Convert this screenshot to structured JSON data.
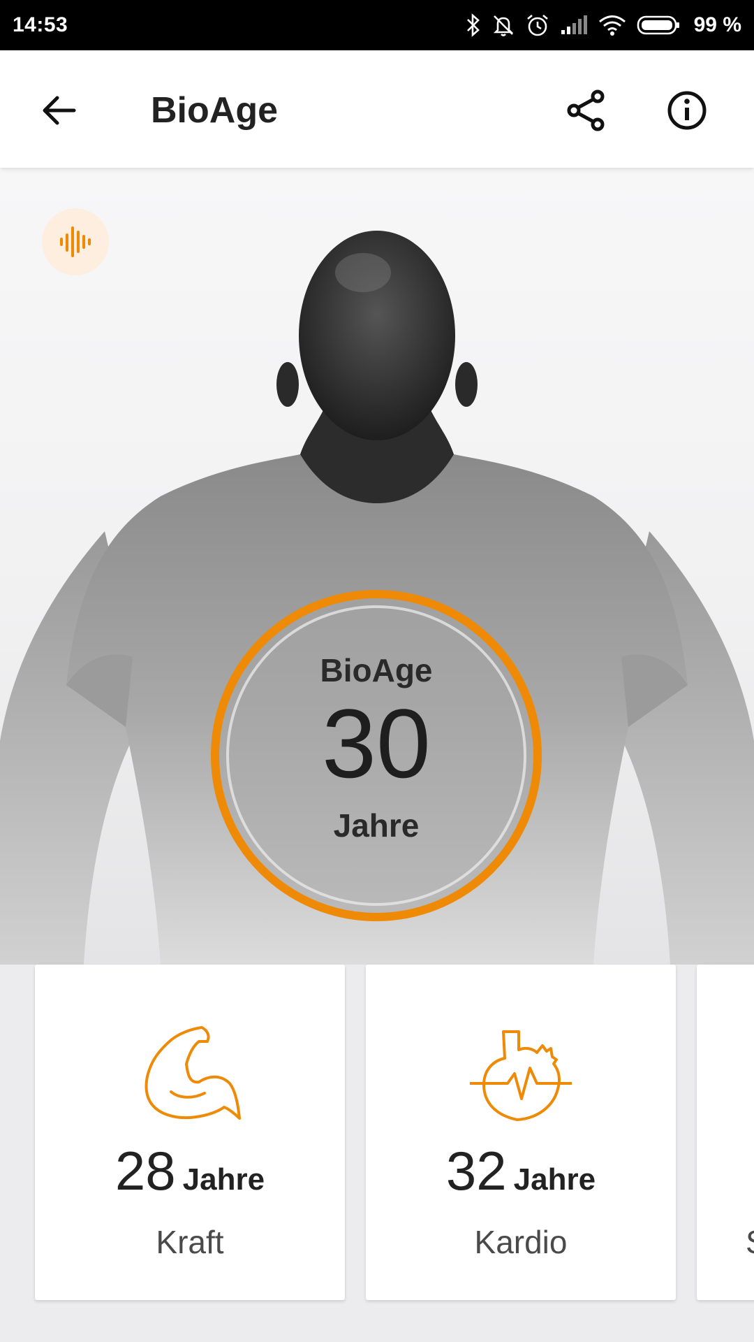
{
  "status_bar": {
    "time": "14:53",
    "battery": "99 %",
    "icons": [
      "bluetooth-icon",
      "bell-muted-icon",
      "alarm-icon",
      "signal-icon",
      "wifi-icon",
      "battery-icon"
    ]
  },
  "app_bar": {
    "title": "BioAge",
    "back_icon": "arrow-left-icon",
    "share_icon": "share-icon",
    "info_icon": "info-icon"
  },
  "hero": {
    "audio_icon": "audio-wave-icon",
    "bioage_label": "BioAge",
    "bioage_value": "30",
    "bioage_unit": "Jahre"
  },
  "cards": [
    {
      "icon": "muscle-arm-icon",
      "value": "28",
      "unit": "Jahre",
      "label": "Kraft"
    },
    {
      "icon": "heart-pulse-icon",
      "value": "32",
      "unit": "Jahre",
      "label": "Kardio"
    },
    {
      "label": "S"
    }
  ],
  "colors": {
    "accent": "#ee8a06",
    "accent_light": "#fdeee0",
    "text_dark": "#222222",
    "status_bar": "#000000"
  }
}
